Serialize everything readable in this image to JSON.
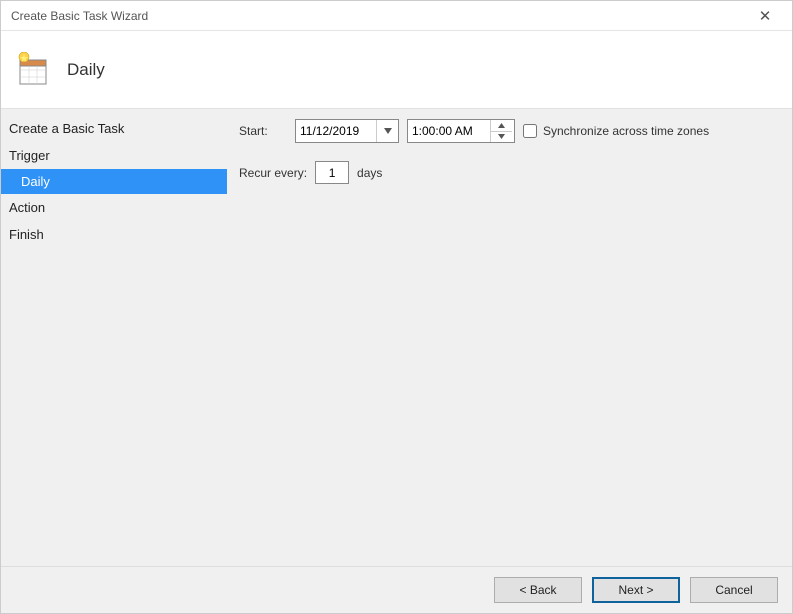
{
  "window": {
    "title": "Create Basic Task Wizard"
  },
  "header": {
    "page_title": "Daily"
  },
  "sidebar": {
    "items": [
      {
        "label": "Create a Basic Task",
        "type": "item"
      },
      {
        "label": "Trigger",
        "type": "item"
      },
      {
        "label": "Daily",
        "type": "subitem",
        "selected": true
      },
      {
        "label": "Action",
        "type": "item"
      },
      {
        "label": "Finish",
        "type": "item"
      }
    ]
  },
  "main": {
    "start_label": "Start:",
    "date_value": "11/12/2019",
    "time_value": "1:00:00 AM",
    "sync_label": "Synchronize across time zones",
    "sync_checked": false,
    "recur_label": "Recur every:",
    "recur_value": "1",
    "recur_unit": "days"
  },
  "footer": {
    "back": "< Back",
    "next": "Next >",
    "cancel": "Cancel"
  }
}
